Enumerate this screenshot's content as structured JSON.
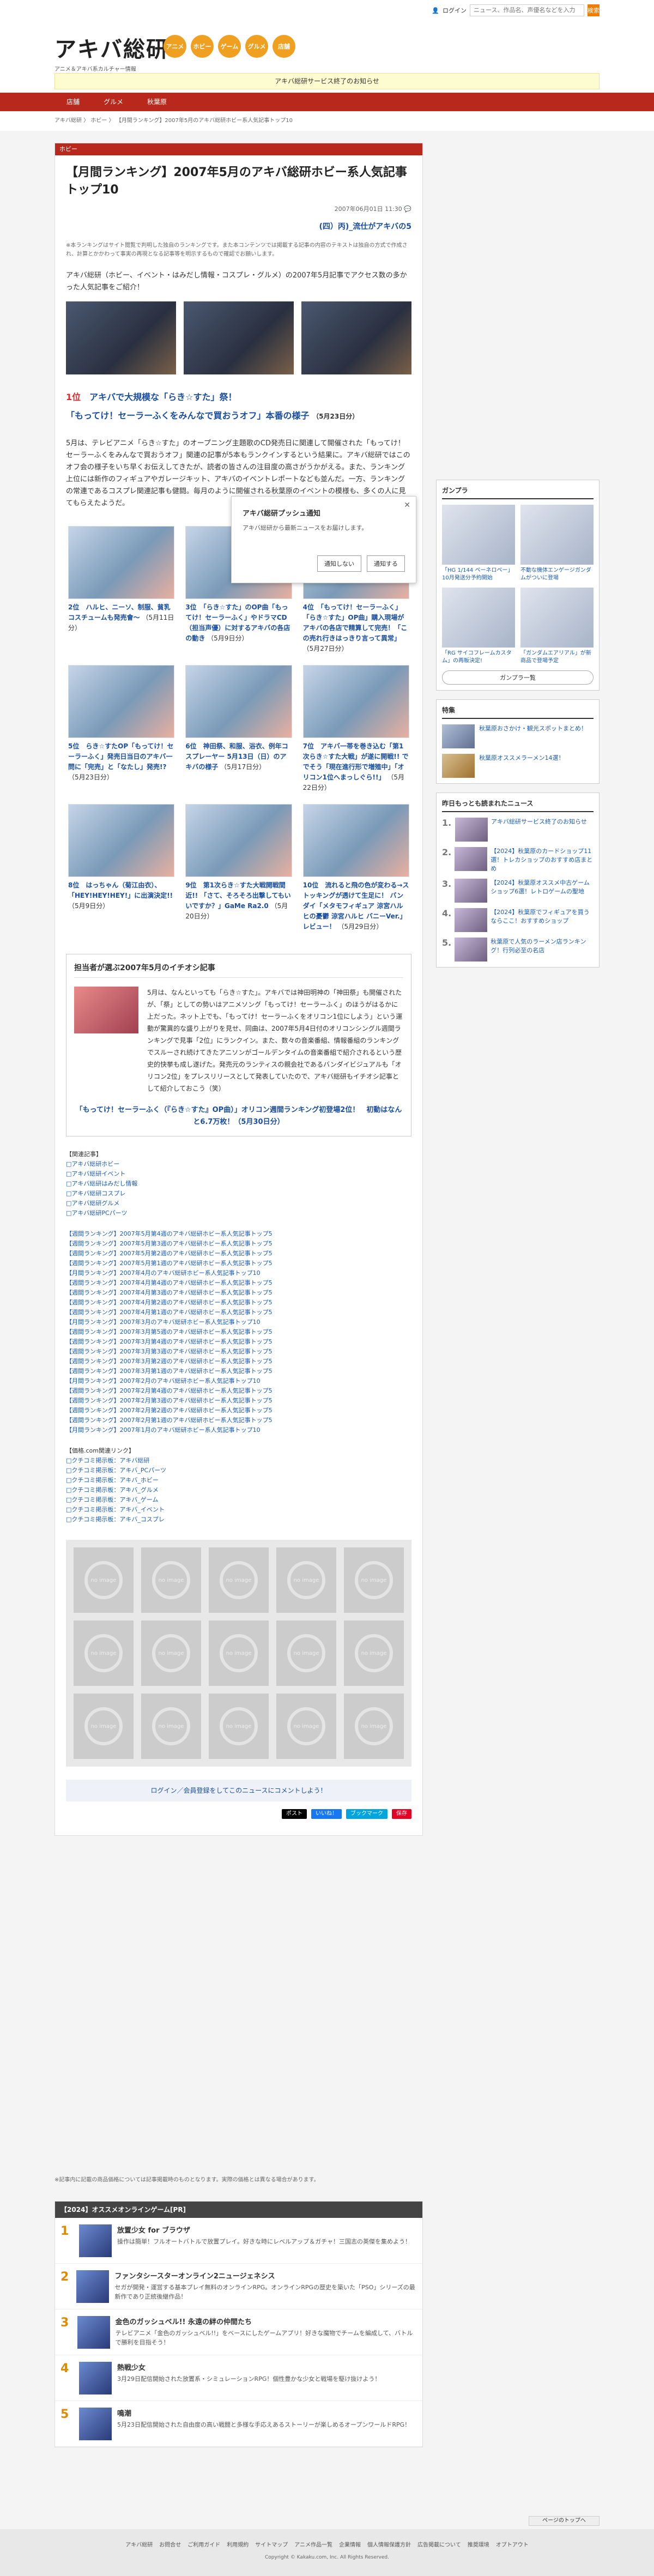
{
  "header": {
    "logo": "アキバ総研",
    "logo_sub": "アニメ＆アキバ系カルチャー情報",
    "categories": [
      "アニメ",
      "ホビー",
      "ゲーム",
      "グルメ",
      "店舗"
    ],
    "login": "ログイン",
    "search_placeholder": "ニュース、作品名、声優名などを入力",
    "search_btn": "検索",
    "notice": "アキバ総研サービス終了のお知らせ"
  },
  "nav": [
    "店舗",
    "グルメ",
    "秋葉原"
  ],
  "breadcrumb": "アキバ総研 〉 ホビー 〉 【月間ランキング】2007年5月のアキバ総研ホビー系人気記事トップ10",
  "article": {
    "tag": "ホビー",
    "title": "【月間ランキング】2007年5月のアキバ総研ホビー系人気記事トップ10",
    "date": "2007年06月01日 11:30",
    "subtitle": "(四）丙)_流仕がアキバの5",
    "note": "※本ランキングはサイト閲覧で判明した独自のランキングです。また本コンテンツでは掲載する記事の内容のテキストは独自の方式で作成され、計算とかかわって事実の再現となる記事等を明示するもので確認でお願いします。",
    "lead": "アキバ総研（ホビー、イベント・はみだし情報・コスプレ・グルメ）の2007年5月記事でアクセス数の多かった人気記事をご紹介！",
    "rank1_num": "1位",
    "rank1_title": "アキバで大規模な「らき☆すた」祭！",
    "rank1_sub": "「もってけ！セーラーふくをみんなで買おうオフ」本番の様子",
    "rank1_date": "（5月23日分）",
    "body": "5月は、テレビアニメ「らき☆すた」のオープニング主題歌のCD発売日に関連して開催された「もってけ！セーラーふくをみんなで買おうオフ」関連の記事が5本もランクインするという結果に。アキバ総研ではこのオフ会の様子をいち早くお伝えしてきたが、読者の皆さんの注目度の高さがうかがえる。また、ランキング上位には新作のフィギュアやガレージキット、アキバのイベントレポートなども並んだ。一方、ランキングの常連であるコスプレ関連記事も健闘。毎月のように開催される秋葉原のイベントの模様も、多くの人に見てもらえたようだ。"
  },
  "popup": {
    "title": "アキバ総研プッシュ通知",
    "text": "アキバ総研から最新ニュースをお届けします。",
    "deny": "通知しない",
    "allow": "通知する"
  },
  "ranks": [
    {
      "rank": "2位",
      "title": "ハルヒ、ニーソ、制服、貧乳コスチュームも発売會～",
      "date": "（5月11日分）"
    },
    {
      "rank": "3位",
      "title": "「らき☆すた」のOP曲「もってけ！セーラーふく」やドラマCD（担当声優）に対するアキバの各店の動き",
      "date": "（5月9日分）"
    },
    {
      "rank": "4位",
      "title": "「もってけ！セーラーふく」「らき☆すた」OP曲」購入現場がアキバの各店で精算して完売！「この売れ行きはっきり言って異常」",
      "date": "（5月27日分）"
    },
    {
      "rank": "5位",
      "title": "らき☆すたOP「もってけ！セーラーふく」発売日当日のアキバ一問に「完売」と「なたし」発売!?",
      "date": "（5月23日分）"
    },
    {
      "rank": "6位",
      "title": "神田祭、和服、浴衣、例年コスプレーヤー 5月13日（日）のアキバの様子",
      "date": "（5月17日分）"
    },
    {
      "rank": "7位",
      "title": "アキバ一帯を巻き込む「第1次らき☆すた大戦」が遂に開戦!! ででそう「現在進行形で増殖中」「オリコン1位へまっしぐら!!」",
      "date": "（5月22日分）"
    },
    {
      "rank": "8位",
      "title": "はっちゃん（菊江由衣）、「HEY!HEY!HEY!」に出演決定!!",
      "date": "（5月9日分）"
    },
    {
      "rank": "9位",
      "title": "第1次らき☆すた大戦開戦間近!! 「さて、そろそろ出撃してもいいですか？」GaMe Ra2.0",
      "date": "（5月20日分）"
    },
    {
      "rank": "10位",
      "title": "流れると飛の色が変わる→ストッキングが透けて生足に！ バンダイ「メタモフィギュア 涼宮ハルヒの憂鬱 涼宮ハルヒ バニーVer.」レビュー！",
      "date": "（5月29日分）"
    }
  ],
  "pick": {
    "heading": "担当者が選ぶ2007年5月のイチオシ記事",
    "text": "5月は、なんといっても「らき☆すた」。アキバでは神田明神の「神田祭」も開催されたが、「祭」としての勢いはアニメソング「もってけ！セーラーふく」のほうがはるかに上だった。ネット上でも、「もってけ！セーラーふくをオリコン1位にしよう」という運動が驚異的な盛り上がりを見せ、同曲は、2007年5月4日付のオリコンシングル週間ランキングで見事「2位」にランクイン。また、数々の音楽番組、情報番組のランキングでスルーされ続けてきたアニソンがゴールデンタイムの音楽番組で紹介されるという歴史的快挙も成し遂げた。発売元のランティスの親会社であるバンダイビジュアルも「オリコン2位」をプレスリリースとして発表していたので、アキバ総研もイチオシ記事として紹介しておこう（笑）",
    "link": "「もってけ！セーラーふく（『らき☆すた』OP曲）」オリコン週間ランキング初登場2位！　初動はなんと6.7万枚！（5月30日分）"
  },
  "related": {
    "label1": "【関連記事】",
    "tags": [
      "□アキバ総研ホビー",
      "□アキバ総研イベント",
      "□アキバ総研はみだし情報",
      "□アキバ総研コスプレ",
      "□アキバ総研グルメ",
      "□アキバ総研PCパーツ"
    ],
    "rankings": [
      "【週間ランキング】2007年5月第4週のアキバ総研ホビー系人気記事トップ5",
      "【週間ランキング】2007年5月第3週のアキバ総研ホビー系人気記事トップ5",
      "【週間ランキング】2007年5月第2週のアキバ総研ホビー系人気記事トップ5",
      "【週間ランキング】2007年5月第1週のアキバ総研ホビー系人気記事トップ5",
      "【月間ランキング】2007年4月のアキバ総研ホビー系人気記事トップ10",
      "【週間ランキング】2007年4月第4週のアキバ総研ホビー系人気記事トップ5",
      "【週間ランキング】2007年4月第3週のアキバ総研ホビー系人気記事トップ5",
      "【週間ランキング】2007年4月第2週のアキバ総研ホビー系人気記事トップ5",
      "【週間ランキング】2007年4月第1週のアキバ総研ホビー系人気記事トップ5",
      "【月間ランキング】2007年3月のアキバ総研ホビー系人気記事トップ10",
      "【週間ランキング】2007年3月第5週のアキバ総研ホビー系人気記事トップ5",
      "【週間ランキング】2007年3月第4週のアキバ総研ホビー系人気記事トップ5",
      "【週間ランキング】2007年3月第3週のアキバ総研ホビー系人気記事トップ5",
      "【週間ランキング】2007年3月第2週のアキバ総研ホビー系人気記事トップ5",
      "【週間ランキング】2007年3月第1週のアキバ総研ホビー系人気記事トップ5",
      "【月間ランキング】2007年2月のアキバ総研ホビー系人気記事トップ10",
      "【週間ランキング】2007年2月第4週のアキバ総研ホビー系人気記事トップ5",
      "【週間ランキング】2007年2月第3週のアキバ総研ホビー系人気記事トップ5",
      "【週間ランキング】2007年2月第2週のアキバ総研ホビー系人気記事トップ5",
      "【週間ランキング】2007年2月第1週のアキバ総研ホビー系人気記事トップ5",
      "【月間ランキング】2007年1月のアキバ総研ホビー系人気記事トップ10"
    ],
    "label2": "【価格.com関連リンク】",
    "kakaku": [
      "□クチコミ掲示板：アキバ総研",
      "□クチコミ掲示板：アキバ_PCパーツ",
      "□クチコミ掲示板：アキバ_ホビー",
      "□クチコミ掲示板：アキバ_グルメ",
      "□クチコミ掲示板：アキバ_ゲーム",
      "□クチコミ掲示板：アキバ_イベント",
      "□クチコミ掲示板：アキバ_コスプレ"
    ]
  },
  "noimage": "no image",
  "comment": "ログイン／会員登録をしてこのニュースにコメントしよう！",
  "share": [
    "ポスト",
    "いいね！",
    "ブックマーク",
    "保存"
  ],
  "footnote": "※記事内に記載の商品価格については記事掲載時のものとなります。実際の価格とは異なる場合があります。",
  "games": {
    "heading": "【2024】オススメオンラインゲーム[PR]",
    "items": [
      {
        "num": "1",
        "title": "放置少女 for ブラウザ",
        "desc": "操作は簡単！フルオートバトルで放置プレイ。好きな時にレベルアップ＆ガチャ！三国志の英傑を集めよう！"
      },
      {
        "num": "2",
        "title": "ファンタシースターオンライン2ニュージェネシス",
        "desc": "セガが開発・運営する基本プレイ無料のオンラインRPG。オンラインRPGの歴史を築いた「PSO」シリーズの最新作であり正統後継作品！"
      },
      {
        "num": "3",
        "title": "金色のガッシュベル!! 永遠の絆の仲間たち",
        "desc": "テレビアニメ「金色のガッシュベル!!」をベースにしたゲームアプリ！好きな魔物でチームを編成して、バトルで勝利を目指そう！"
      },
      {
        "num": "4",
        "title": "熱戦少女",
        "desc": "3月29日配信開始された放置系・シミュレーションRPG！個性豊かな少女と戦場を駆け抜けよう！"
      },
      {
        "num": "5",
        "title": "鳴潮",
        "desc": "5月23日配信開始された自由度の高い戦闘と多様な手応えあるストーリーが楽しめるオープンワールドRPG！"
      }
    ]
  },
  "side": {
    "gunpla_h": "ガンプラ",
    "gunpla": [
      {
        "cap": "「HG 1/144 ペーネロペー」10月発送分予約開始"
      },
      {
        "cap": "不動な機体エンゲージガンダムがついに登場"
      },
      {
        "cap": "「RG サイコフレームカスタム」の再販決定!"
      },
      {
        "cap": "「ガンダムエアリアル」が新商品で登場予定"
      }
    ],
    "gunpla_btn": "ガンプラ一覧",
    "tokushu_h": "特集",
    "tokushu": [
      "秋葉原おさかけ・観光スポットまとめ！",
      "秋葉原オススメラーメン14選！"
    ],
    "ranking_h": "昨日もっとも読まれたニュース",
    "ranking": [
      {
        "n": "1.",
        "t": "アキバ総研サービス終了のお知らせ"
      },
      {
        "n": "2.",
        "t": "【2024】秋葉原のカードショップ11選！トレカショップのおすすめ店まとめ"
      },
      {
        "n": "3.",
        "t": "【2024】秋葉原オススメ中古ゲームショップ6選！レトロゲームの聖地"
      },
      {
        "n": "4.",
        "t": "【2024】秋葉原でフィギュアを買うならここ！おすすめショップ"
      },
      {
        "n": "5.",
        "t": "秋葉原で人気のラーメン店ランキング！行列必至の名店"
      }
    ]
  },
  "footer": {
    "links": [
      "アキバ総研",
      "お問合せ",
      "ご利用ガイド",
      "利用規約",
      "サイトマップ",
      "アニメ作品一覧",
      "企業情報",
      "個人情報保護方針",
      "広告掲載について",
      "推奨環境",
      "オプトアウト"
    ],
    "copy": "Copyright © Kakaku.com, Inc. All Rights Reserved.",
    "pagetop": "ページのトップへ"
  }
}
